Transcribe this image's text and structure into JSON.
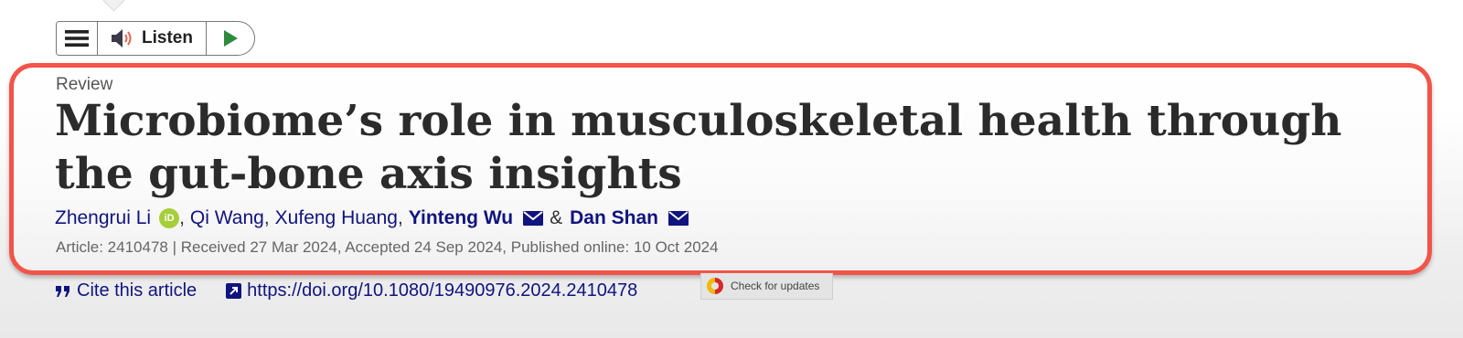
{
  "toolbar": {
    "menu_icon": "hamburger-menu-icon",
    "listen_label": "Listen",
    "speaker_icon": "speaker-icon",
    "play_icon": "play-icon",
    "play_color": "#2e8b3d"
  },
  "article": {
    "type": "Review",
    "title": "Microbiome’s role in musculoskeletal health through the gut-bone axis insights",
    "authors": [
      {
        "name": "Zhengrui Li",
        "orcid": true,
        "email": false,
        "bold": false
      },
      {
        "name": "Qi Wang",
        "orcid": false,
        "email": false,
        "bold": false
      },
      {
        "name": "Xufeng Huang",
        "orcid": false,
        "email": false,
        "bold": false
      },
      {
        "name": "Yinteng Wu",
        "orcid": false,
        "email": true,
        "bold": true
      },
      {
        "name": "Dan Shan",
        "orcid": false,
        "email": true,
        "bold": true
      }
    ],
    "orcid_label": "iD",
    "separator": ",",
    "ampersand": "&",
    "meta": "Article: 2410478 | Received 27 Mar 2024, Accepted 24 Sep 2024, Published online: 10 Oct 2024"
  },
  "links": {
    "cite_label": "Cite this article",
    "doi_label": "https://doi.org/10.1080/19490976.2024.2410478",
    "updates_label": "Check for updates"
  },
  "colors": {
    "highlight": "#f2544a",
    "link": "#10147e",
    "orcid": "#a6ce39"
  }
}
